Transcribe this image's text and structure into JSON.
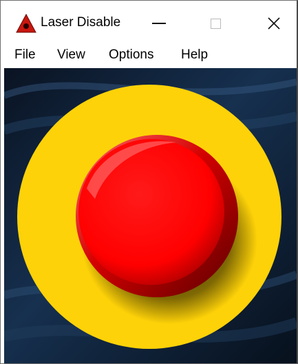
{
  "window": {
    "title": "Laser Disable",
    "app_icon": "warning-triangle-icon",
    "controls": {
      "minimize": "minimize-icon",
      "maximize": "maximize-icon",
      "close": "close-icon",
      "close_glyph": "✕"
    }
  },
  "menu": {
    "items": [
      {
        "label": "File"
      },
      {
        "label": "View"
      },
      {
        "label": "Options"
      },
      {
        "label": "Help"
      }
    ]
  },
  "emergency_button": {
    "icon": "emergency-stop-button",
    "colors": {
      "ring": "#fed208",
      "button": "#ff0000",
      "button_dark": "#8a0000",
      "background": "#0b1524"
    }
  }
}
